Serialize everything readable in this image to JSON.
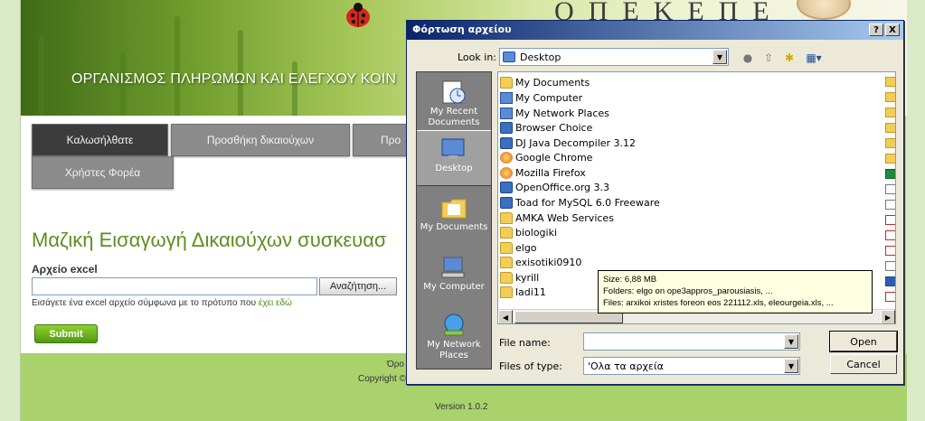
{
  "page": {
    "banner_title": "ΟΡΓΑΝΙΣΜΟΣ ΠΛΗΡΩΜΩΝ ΚΑΙ ΕΛΕΓΧΟΥ ΚΟΙΝ",
    "brand": "ΟΠΕΚΕΠΕ",
    "nav": {
      "welcome": "Καλωσήλθατε",
      "add_beneficiaries": "Προσθήκη δικαιούχων",
      "third": "Προ",
      "users": "Χρήστες Φορέα"
    },
    "heading": "Μαζική Εισαγωγή Δικαιούχων συσκευασ",
    "file_label": "Αρχείο excel",
    "file_value": "",
    "browse_label": "Αναζήτηση...",
    "hint_text": "Εισάγετε ένα excel αρχείο σύμφωνα με το πρότυπο που",
    "hint_link": "έχει εδώ",
    "submit_label": "Submit",
    "footer_line1": "Όρο",
    "footer_line2": "Copyright ©",
    "version": "Version 1.0.2"
  },
  "dialog": {
    "title": "Φόρτωση αρχείου",
    "help_label": "?",
    "close_label": "X",
    "look_in_label": "Look in:",
    "look_in_value": "Desktop",
    "places": [
      {
        "label": "My Recent Documents"
      },
      {
        "label": "Desktop"
      },
      {
        "label": "My Documents"
      },
      {
        "label": "My Computer"
      },
      {
        "label": "My Network Places"
      }
    ],
    "files": [
      {
        "name": "My Documents",
        "icon": "folder-icon"
      },
      {
        "name": "My Computer",
        "icon": "computer-icon"
      },
      {
        "name": "My Network Places",
        "icon": "network-icon"
      },
      {
        "name": "Browser Choice",
        "icon": "shortcut-icon"
      },
      {
        "name": "DJ Java Decompiler 3.12",
        "icon": "app-icon"
      },
      {
        "name": "Google Chrome",
        "icon": "chrome-icon"
      },
      {
        "name": "Mozilla Firefox",
        "icon": "firefox-icon"
      },
      {
        "name": "OpenOffice.org 3.3",
        "icon": "app-icon"
      },
      {
        "name": "Toad for MySQL 6.0 Freeware",
        "icon": "app-icon"
      },
      {
        "name": "AMKA Web Services",
        "icon": "folder-icon"
      },
      {
        "name": "biologiki",
        "icon": "folder-icon"
      },
      {
        "name": "elgo",
        "icon": "folder-icon"
      },
      {
        "name": "exisotiki0910",
        "icon": "folder-icon"
      },
      {
        "name": "kyrill",
        "icon": "folder-icon"
      },
      {
        "name": "ladi11",
        "icon": "folder-icon"
      }
    ],
    "tooltip": {
      "size": "Size: 6,88 MB",
      "folders": "Folders: elgo on ope3appros_parousiasis, ...",
      "files": "Files: arxikoi xristes foreon eos 221112.xls, eleourgeia.xls, ..."
    },
    "file_name_label": "File name:",
    "file_name_value": "",
    "files_of_type_label": "Files of type:",
    "files_of_type_value": "'Ολα τα αρχεία",
    "open_label": "Open",
    "cancel_label": "Cancel"
  }
}
